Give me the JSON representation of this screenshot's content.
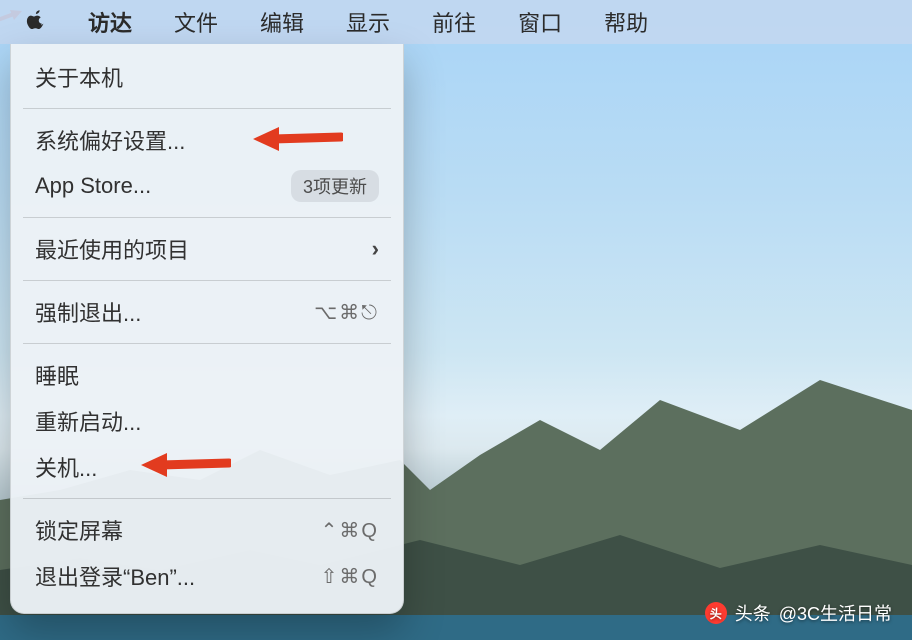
{
  "menubar": {
    "items": [
      {
        "label": "访达",
        "active": true
      },
      {
        "label": "文件"
      },
      {
        "label": "编辑"
      },
      {
        "label": "显示"
      },
      {
        "label": "前往"
      },
      {
        "label": "窗口"
      },
      {
        "label": "帮助"
      }
    ]
  },
  "apple_menu": {
    "about": "关于本机",
    "system_prefs": "系统偏好设置...",
    "app_store": {
      "label": "App Store...",
      "badge": "3项更新"
    },
    "recent_items": "最近使用的项目",
    "force_quit": {
      "label": "强制退出...",
      "shortcut": "⌥⌘⎋"
    },
    "sleep": "睡眠",
    "restart": "重新启动...",
    "shutdown": "关机...",
    "lock_screen": {
      "label": "锁定屏幕",
      "shortcut": "⌃⌘Q"
    },
    "logout": {
      "label": "退出登录“Ben”...",
      "shortcut": "⇧⌘Q"
    }
  },
  "watermark": {
    "prefix": "头条",
    "handle": "@3C生活日常"
  }
}
